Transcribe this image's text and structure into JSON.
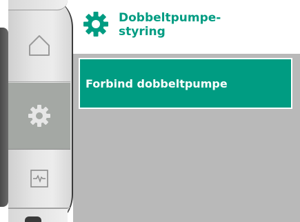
{
  "header": {
    "icon": "gear-icon",
    "title_line1": "Dobbeltpumpe-",
    "title_line2": "styring"
  },
  "sidebar": {
    "items": [
      {
        "icon": "home-icon",
        "selected": false
      },
      {
        "icon": "gear-icon",
        "selected": true
      },
      {
        "icon": "diagnostics-icon",
        "selected": false
      }
    ]
  },
  "menu": {
    "items": [
      {
        "label": "Forbind dobbeltpumpe",
        "selected": true
      }
    ]
  },
  "colors": {
    "accent": "#009c82",
    "panel": "#b9b9b9",
    "selected_drum": "#a4a8a4"
  }
}
